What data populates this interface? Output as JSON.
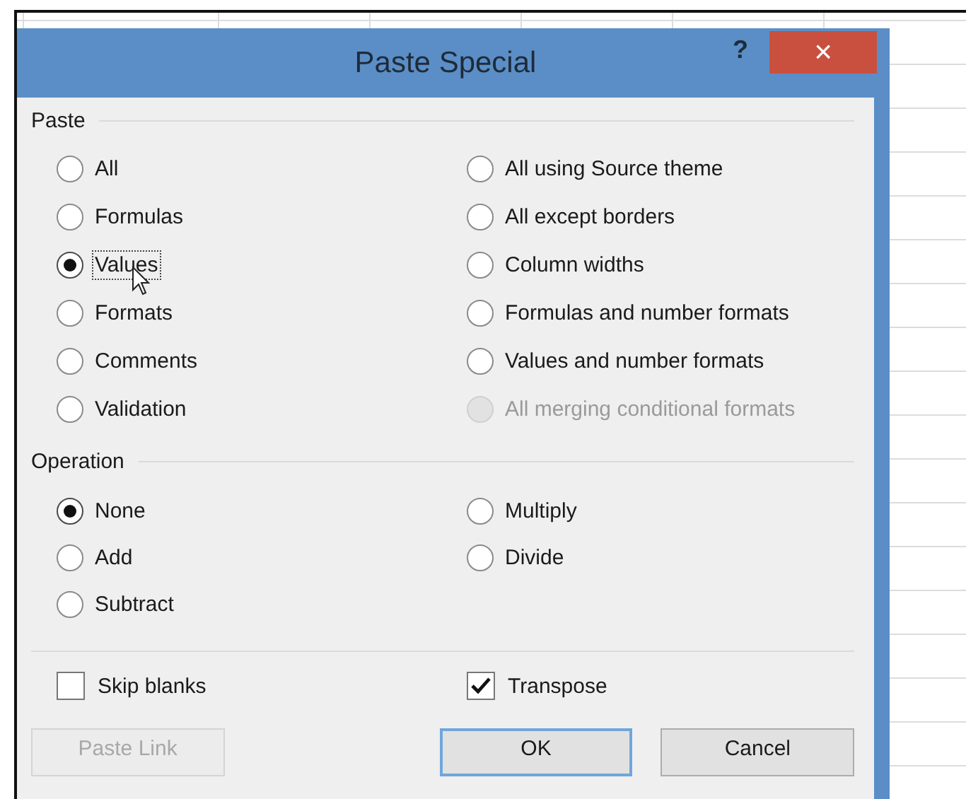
{
  "window": {
    "title": "Paste Special",
    "help": "?",
    "close": "×"
  },
  "paste": {
    "label": "Paste",
    "columns": [
      [
        {
          "label": "All",
          "selected": false,
          "disabled": false,
          "focused": false
        },
        {
          "label": "Formulas",
          "selected": false,
          "disabled": false,
          "focused": false
        },
        {
          "label": "Values",
          "selected": true,
          "disabled": false,
          "focused": true
        },
        {
          "label": "Formats",
          "selected": false,
          "disabled": false,
          "focused": false
        },
        {
          "label": "Comments",
          "selected": false,
          "disabled": false,
          "focused": false
        },
        {
          "label": "Validation",
          "selected": false,
          "disabled": false,
          "focused": false
        }
      ],
      [
        {
          "label": "All using Source theme",
          "selected": false,
          "disabled": false,
          "focused": false
        },
        {
          "label": "All except borders",
          "selected": false,
          "disabled": false,
          "focused": false
        },
        {
          "label": "Column widths",
          "selected": false,
          "disabled": false,
          "focused": false
        },
        {
          "label": "Formulas and number formats",
          "selected": false,
          "disabled": false,
          "focused": false
        },
        {
          "label": "Values and number formats",
          "selected": false,
          "disabled": false,
          "focused": false
        },
        {
          "label": "All merging conditional formats",
          "selected": false,
          "disabled": true,
          "focused": false
        }
      ]
    ]
  },
  "operation": {
    "label": "Operation",
    "columns": [
      [
        {
          "label": "None",
          "selected": true,
          "disabled": false,
          "focused": false
        },
        {
          "label": "Add",
          "selected": false,
          "disabled": false,
          "focused": false
        },
        {
          "label": "Subtract",
          "selected": false,
          "disabled": false,
          "focused": false
        }
      ],
      [
        {
          "label": "Multiply",
          "selected": false,
          "disabled": false,
          "focused": false
        },
        {
          "label": "Divide",
          "selected": false,
          "disabled": false,
          "focused": false
        }
      ]
    ]
  },
  "checkboxes": [
    {
      "label": "Skip blanks",
      "checked": false
    },
    {
      "label": "Transpose",
      "checked": true
    }
  ],
  "buttons": [
    {
      "label": "Paste Link",
      "disabled": true,
      "default": false
    },
    {
      "label": "OK",
      "disabled": false,
      "default": true
    },
    {
      "label": "Cancel",
      "disabled": false,
      "default": false
    }
  ]
}
